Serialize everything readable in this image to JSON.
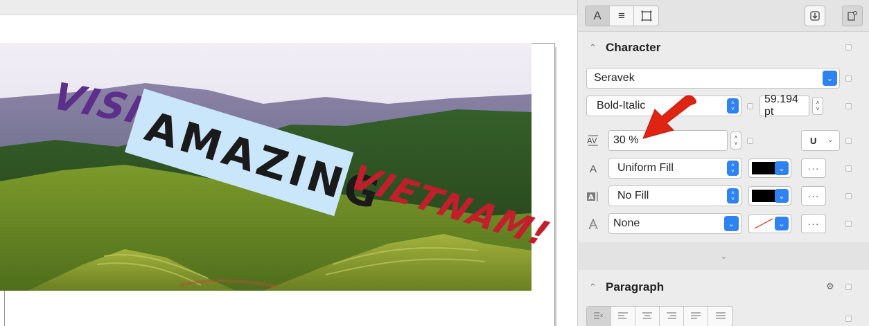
{
  "canvas": {
    "headline": {
      "word1": "VISIT",
      "word2": "AMAZING",
      "word3": "VIETNAM!"
    }
  },
  "panel": {
    "tabs": [
      {
        "icon": "character-tab-icon",
        "glyph": "A"
      },
      {
        "icon": "paragraph-tab-icon",
        "glyph": "≡"
      },
      {
        "icon": "frame-tab-icon",
        "glyph": "⌗"
      }
    ],
    "character": {
      "title": "Character",
      "font_family": "Seravek",
      "font_style": "Bold-Italic",
      "font_size": "59.194 pt",
      "kerning": "30 %",
      "underline_label": "U",
      "fill_type": "Uniform Fill",
      "fill_color": "#000000",
      "background_fill": "No Fill",
      "background_color": "#000000",
      "outline": "None",
      "more_label": "···"
    },
    "paragraph": {
      "title": "Paragraph"
    },
    "align_buttons": [
      {
        "name": "align-none",
        "glyph": "≡ˣ"
      },
      {
        "name": "align-left",
        "glyph": "☰"
      },
      {
        "name": "align-center",
        "glyph": "☰"
      },
      {
        "name": "align-right",
        "glyph": "☰"
      },
      {
        "name": "align-justify",
        "glyph": "☰"
      },
      {
        "name": "align-force-justify",
        "glyph": "☰"
      }
    ],
    "colors": {
      "accent": "#2e82f1",
      "arrow": "#e02414"
    }
  }
}
